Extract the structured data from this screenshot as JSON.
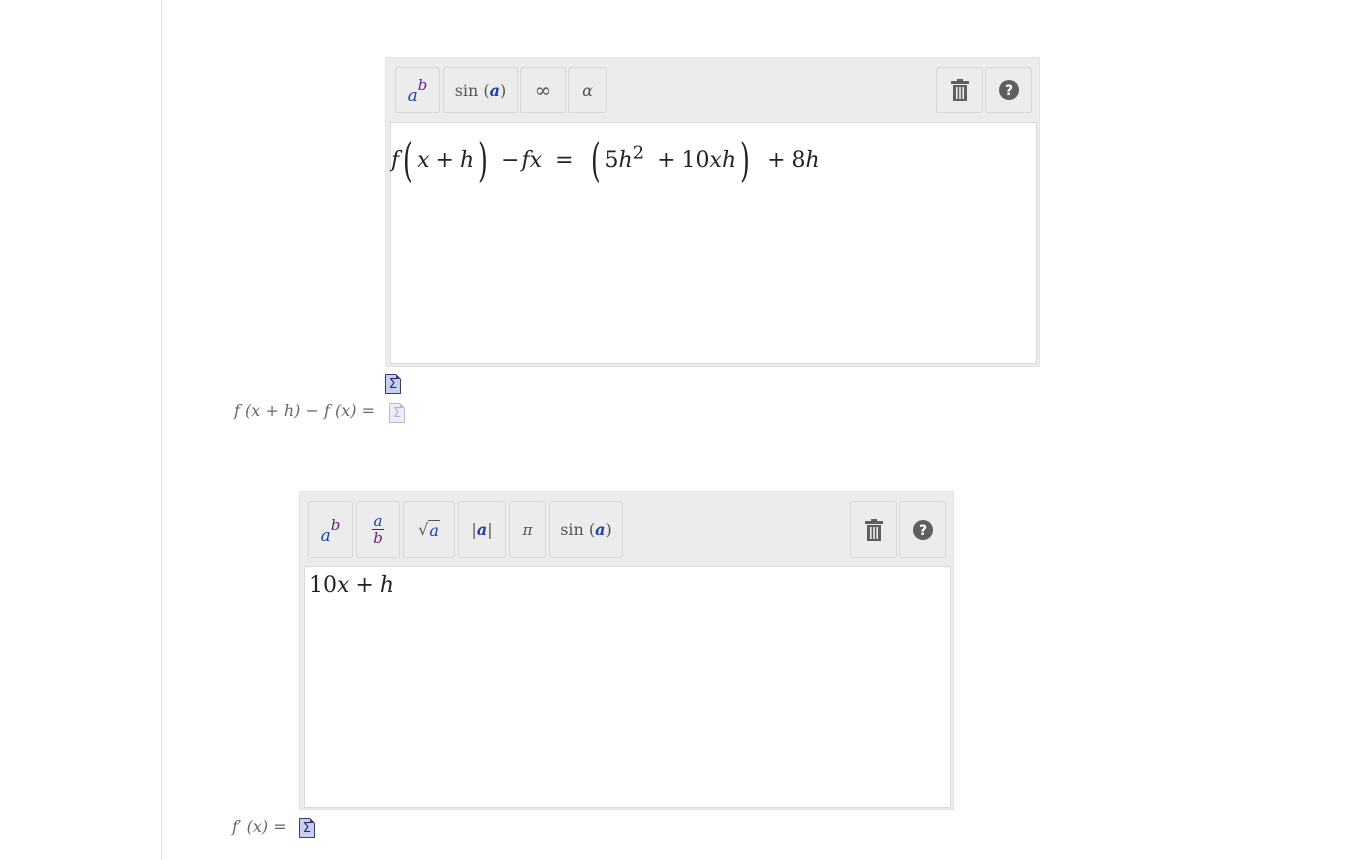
{
  "editor1": {
    "toolbar": {
      "power_base": "a",
      "power_exp": "b",
      "sin_fn": "sin",
      "sin_arg": "a",
      "infinity": "∞",
      "alpha": "α"
    },
    "expression": {
      "f": "f",
      "x": "x",
      "plus": "+",
      "h": "h",
      "minus": "−",
      "fx": "fx",
      "eq": "=",
      "five": "5",
      "h2": "h",
      "sq": "2",
      "term2": "10",
      "xh": "xh",
      "term3": "8"
    }
  },
  "label1": {
    "lhs": "f (x + h) − f (x) ="
  },
  "editor2": {
    "toolbar": {
      "power_base": "a",
      "power_exp": "b",
      "frac_num": "a",
      "frac_den": "b",
      "sqrt_arg": "a",
      "abs_arg": "a",
      "pi": "π",
      "sin_fn": "sin",
      "sin_arg": "a"
    },
    "expression": {
      "ten": "10",
      "x": "x",
      "plus": "+",
      "h": "h"
    }
  },
  "label2": {
    "f": "f",
    "prime": "′",
    "rest": " (x) ="
  },
  "icons": {
    "sigma": "Σ",
    "trash": "trash-icon",
    "help": "help-icon"
  },
  "colors": {
    "toolbar_bg": "#ececec",
    "icon_dark": "#5f5f5f",
    "var_blue": "#1a3fae",
    "var_purple": "#6a1b7a"
  }
}
